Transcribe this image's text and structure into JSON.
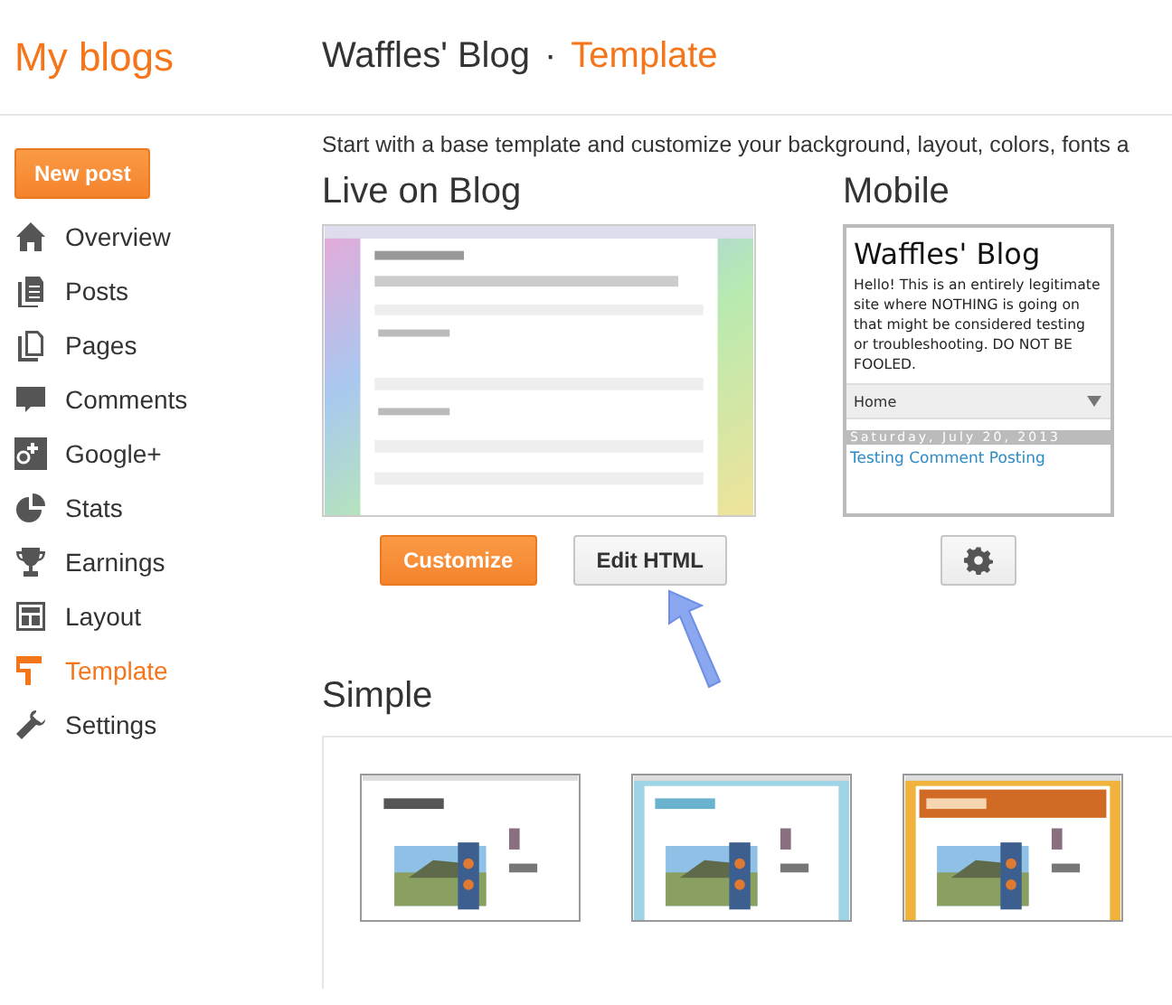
{
  "sidebar": {
    "title": "My blogs",
    "new_post": "New post",
    "items": [
      {
        "label": "Overview",
        "selected": false
      },
      {
        "label": "Posts",
        "selected": false
      },
      {
        "label": "Pages",
        "selected": false
      },
      {
        "label": "Comments",
        "selected": false
      },
      {
        "label": "Google+",
        "selected": false
      },
      {
        "label": "Stats",
        "selected": false
      },
      {
        "label": "Earnings",
        "selected": false
      },
      {
        "label": "Layout",
        "selected": false
      },
      {
        "label": "Template",
        "selected": true
      },
      {
        "label": "Settings",
        "selected": false
      }
    ]
  },
  "header": {
    "blog": "Waffles' Blog",
    "separator": "·",
    "section": "Template"
  },
  "intro": "Start with a base template and customize your background, layout, colors, fonts a",
  "live": {
    "heading": "Live on Blog",
    "preview": {
      "kind": "picture"
    },
    "buttons": [
      "Customize",
      "Edit HTML"
    ]
  },
  "mobile": {
    "heading": "Mobile",
    "preview": {
      "title": "Waffles' Blog",
      "description": "Hello! This is an entirely legitimate site where NOTHING is going on that might be considered testing or troubleshooting. DO NOT BE FOOLED.",
      "nav": "Home",
      "date": "Saturday, July 20, 2013",
      "post": "Testing Comment Posting"
    }
  },
  "simple": {
    "heading": "Simple",
    "templates": [
      {
        "kind": "picture"
      },
      {
        "kind": "picture"
      },
      {
        "kind": "picture"
      }
    ]
  }
}
